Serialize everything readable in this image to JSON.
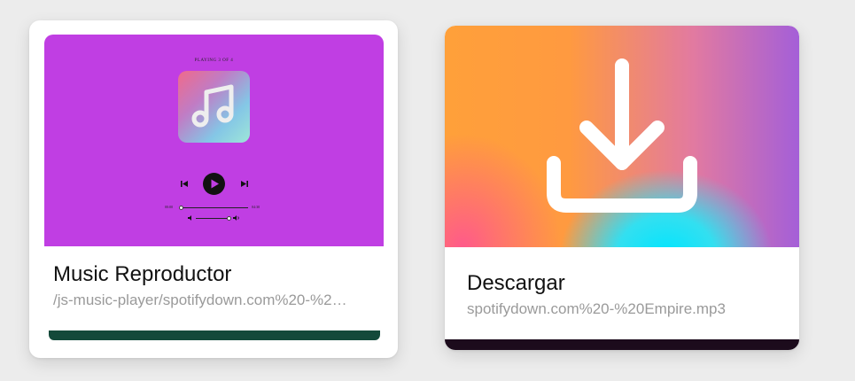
{
  "cards": [
    {
      "title": "Music Reproductor",
      "subtitle": "/js-music-player/spotifydown.com%20-%2…",
      "thumbnail": {
        "background": "#c03ee3",
        "playing_text": "PLAYING 3 OF 4",
        "current_time": "00:00",
        "duration": "04:30",
        "music-note-icon": "music-note-icon"
      },
      "accent_bar_color": "#13493a"
    },
    {
      "title": "Descargar",
      "subtitle": "spotifydown.com%20-%20Empire.mp3",
      "thumbnail": {
        "icon": "download-icon"
      },
      "accent_bar_color": "#1c0b1c"
    }
  ]
}
